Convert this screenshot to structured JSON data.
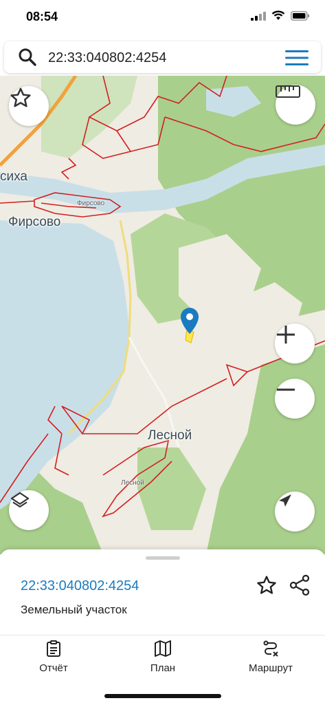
{
  "status_bar": {
    "time": "08:54"
  },
  "search": {
    "value": "22:33:040802:4254"
  },
  "map": {
    "labels": {
      "sikha": "сиха",
      "firsovo": "Фирсово",
      "lesnoy": "Лесной",
      "small_upper": "Фирсово",
      "small_lower": "Лесной"
    },
    "controls": [
      "favorite-icon",
      "ruler-icon",
      "zoom-in-icon",
      "zoom-out-icon",
      "layers-icon",
      "location-icon"
    ]
  },
  "sheet": {
    "title": "22:33:040802:4254",
    "subtitle": "Земельный участок"
  },
  "tabs": [
    {
      "label": "Отчёт",
      "icon": "report-icon"
    },
    {
      "label": "План",
      "icon": "map-plan-icon"
    },
    {
      "label": "Маршрут",
      "icon": "route-icon"
    }
  ],
  "colors": {
    "accent": "#1a7bc0",
    "parcel_border": "#d21f1f",
    "water": "#c9dfe8",
    "forest": "#a9cf8c",
    "land": "#efece3"
  }
}
